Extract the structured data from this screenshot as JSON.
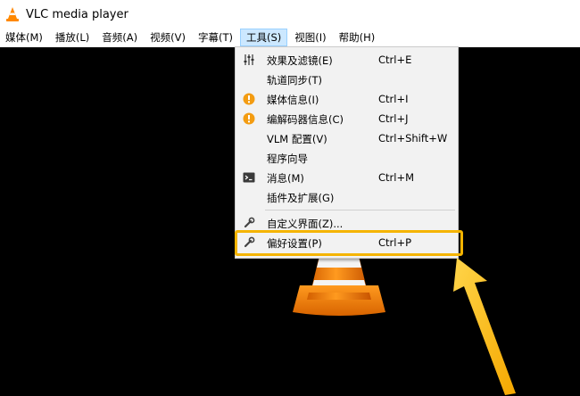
{
  "window": {
    "title": "VLC media player"
  },
  "menubar": {
    "items": [
      {
        "label": "媒体(M)"
      },
      {
        "label": "播放(L)"
      },
      {
        "label": "音频(A)"
      },
      {
        "label": "视频(V)"
      },
      {
        "label": "字幕(T)"
      },
      {
        "label": "工具(S)",
        "active": true
      },
      {
        "label": "视图(I)"
      },
      {
        "label": "帮助(H)"
      }
    ]
  },
  "tools_menu": {
    "items": [
      {
        "label": "效果及滤镜(E)",
        "shortcut": "Ctrl+E",
        "icon": "equalizer-icon"
      },
      {
        "label": "轨道同步(T)",
        "shortcut": "",
        "icon": ""
      },
      {
        "label": "媒体信息(I)",
        "shortcut": "Ctrl+I",
        "icon": "info-icon"
      },
      {
        "label": "编解码器信息(C)",
        "shortcut": "Ctrl+J",
        "icon": "info-icon"
      },
      {
        "label": "VLM 配置(V)",
        "shortcut": "Ctrl+Shift+W",
        "icon": ""
      },
      {
        "label": "程序向导",
        "shortcut": "",
        "icon": ""
      },
      {
        "label": "消息(M)",
        "shortcut": "Ctrl+M",
        "icon": "terminal-icon"
      },
      {
        "label": "插件及扩展(G)",
        "shortcut": "",
        "icon": ""
      },
      {
        "label": "自定义界面(Z)...",
        "shortcut": "",
        "icon": "wrench-icon"
      },
      {
        "label": "偏好设置(P)",
        "shortcut": "Ctrl+P",
        "icon": "wrench-icon"
      }
    ]
  },
  "colors": {
    "highlight": "#f5b400",
    "info": "#f39c12",
    "cone_orange": "#ff8800",
    "menu_active_bg": "#cce8ff"
  }
}
